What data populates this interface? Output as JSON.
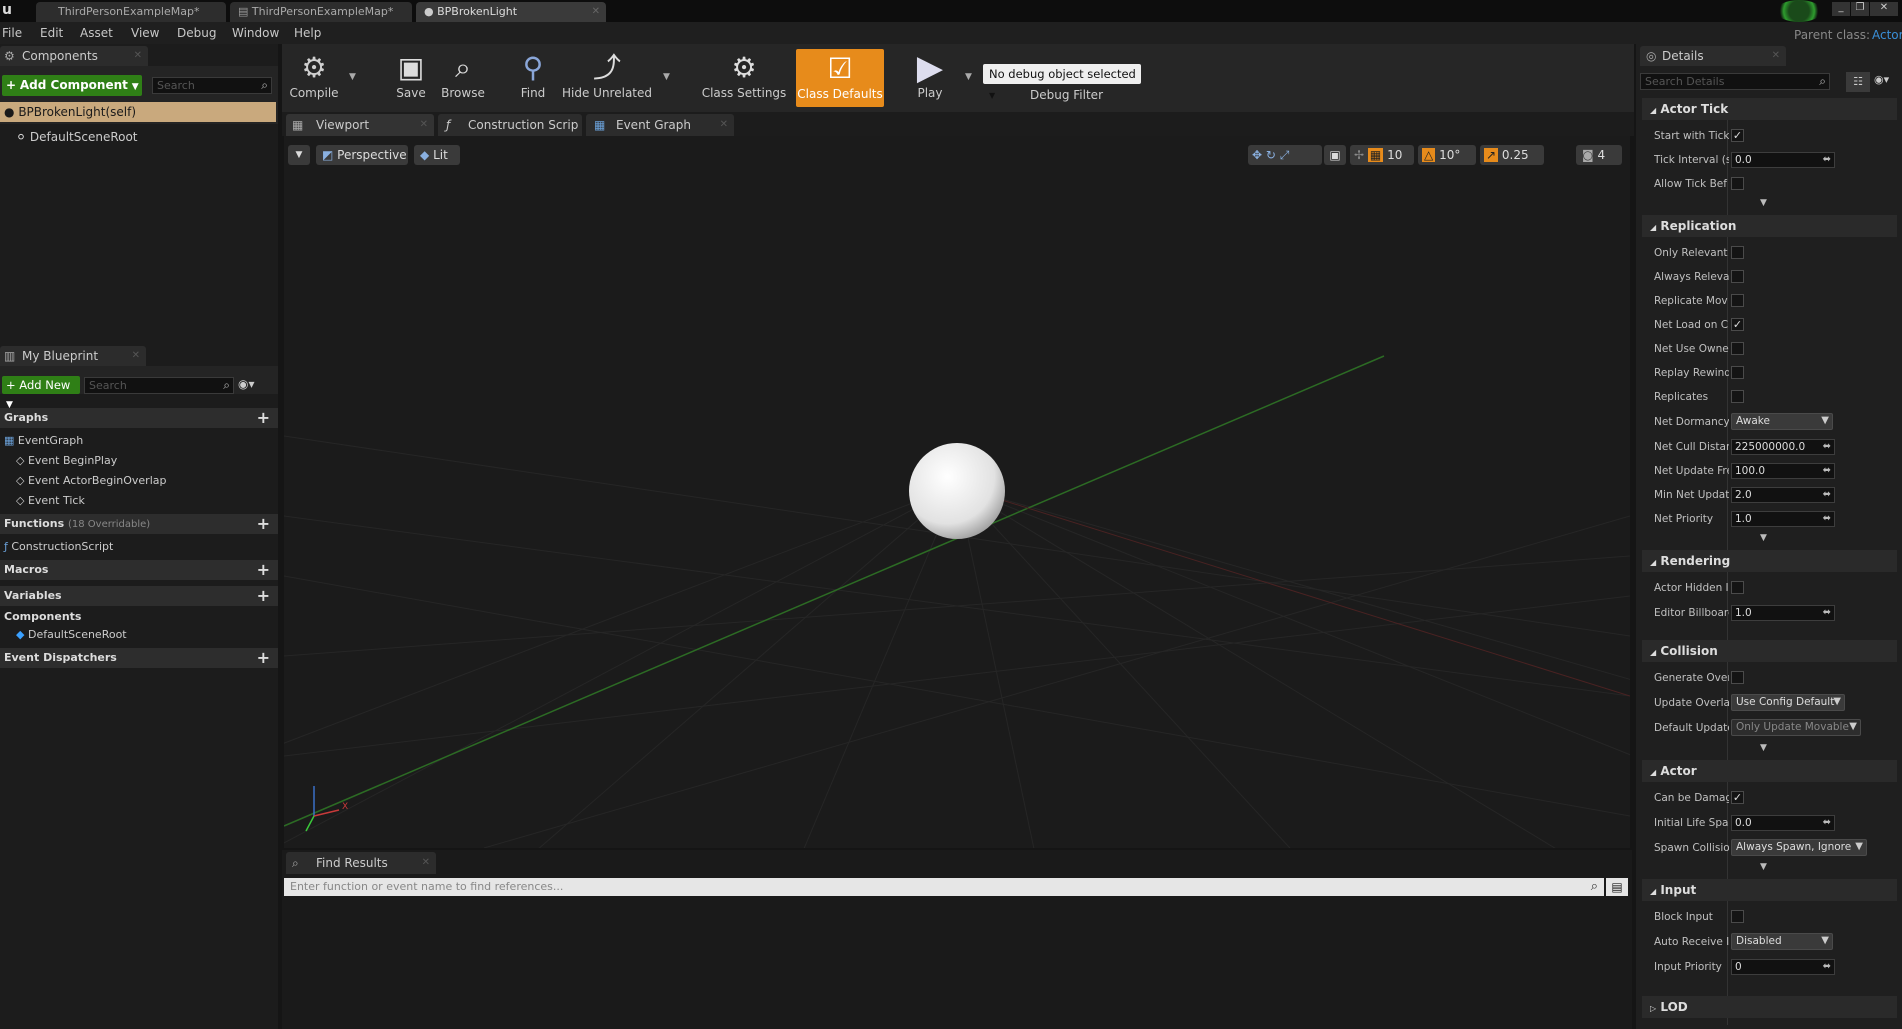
{
  "document_tabs": [
    {
      "label": "ThirdPersonExampleMap*"
    },
    {
      "label": "ThirdPersonExampleMap*"
    },
    {
      "label": "BPBrokenLight"
    }
  ],
  "parent_class": {
    "label": "Parent class:",
    "value": "Actor"
  },
  "menu": [
    "File",
    "Edit",
    "Asset",
    "View",
    "Debug",
    "Window",
    "Help"
  ],
  "components_panel": {
    "tab": "Components",
    "add_button": "Add Component",
    "search_placeholder": "Search",
    "items": [
      "BPBrokenLight(self)",
      "DefaultSceneRoot"
    ]
  },
  "my_blueprint": {
    "tab": "My Blueprint",
    "add_button": "Add New",
    "search_placeholder": "Search",
    "graphs_label": "Graphs",
    "event_graph": "EventGraph",
    "events": [
      "Event BeginPlay",
      "Event ActorBeginOverlap",
      "Event Tick"
    ],
    "functions_label": "Functions",
    "functions_count": "(18 Overridable)",
    "construction_script": "ConstructionScript",
    "macros_label": "Macros",
    "variables_label": "Variables",
    "components_label": "Components",
    "component_item": "DefaultSceneRoot",
    "dispatchers_label": "Event Dispatchers"
  },
  "toolbar": {
    "compile": "Compile",
    "save": "Save",
    "browse": "Browse",
    "find": "Find",
    "hide_unrelated": "Hide Unrelated",
    "class_settings": "Class Settings",
    "class_defaults": "Class Defaults",
    "play": "Play",
    "debug_select": "No debug object selected",
    "debug_filter": "Debug Filter"
  },
  "editor_tabs": [
    "Viewport",
    "Construction Scrip",
    "Event Graph"
  ],
  "viewport": {
    "perspective": "Perspective",
    "lit": "Lit",
    "grid_snap": "10",
    "rotation_snap": "10°",
    "scale_snap": "0.25",
    "camera_speed": "4",
    "axis_x": "X"
  },
  "find_results": {
    "tab": "Find Results",
    "placeholder": "Enter function or event name to find references..."
  },
  "details": {
    "tab": "Details",
    "search_placeholder": "Search Details",
    "sections": {
      "actor_tick": "Actor Tick",
      "replication": "Replication",
      "rendering": "Rendering",
      "collision": "Collision",
      "actor": "Actor",
      "input": "Input",
      "lod": "LOD"
    },
    "props": {
      "start_with_tick": "Start with Tick",
      "tick_interval": "Tick Interval (s",
      "tick_interval_val": "0.0",
      "allow_tick": "Allow Tick Bef",
      "only_relevant": "Only Relevant",
      "always_relevant": "Always Releva",
      "replicate_movement": "Replicate Mov",
      "net_load": "Net Load on Cl",
      "net_use_owner": "Net Use Owner",
      "replay_rewind": "Replay Rewind",
      "replicates": "Replicates",
      "net_dormancy": "Net Dormancy",
      "net_dormancy_val": "Awake",
      "net_cull": "Net Cull Distar",
      "net_cull_val": "225000000.0",
      "net_update_freq": "Net Update Fre",
      "net_update_freq_val": "100.0",
      "min_net_update": "Min Net Updat",
      "min_net_update_val": "2.0",
      "net_priority": "Net Priority",
      "net_priority_val": "1.0",
      "actor_hidden": "Actor Hidden I",
      "editor_billboard": "Editor Billboarc",
      "editor_billboard_val": "1.0",
      "generate_overlap": "Generate Over",
      "update_overlap": "Update Overla",
      "update_overlap_val": "Use Config Default",
      "default_update": "Default Update",
      "default_update_val": "Only Update Movable",
      "can_be_damaged": "Can be Damag",
      "initial_life": "Initial Life Spa",
      "initial_life_val": "0.0",
      "spawn_collision": "Spawn Collisio",
      "spawn_collision_val": "Always Spawn, Ignore C",
      "block_input": "Block Input",
      "auto_receive": "Auto Receive I",
      "auto_receive_val": "Disabled",
      "input_priority": "Input Priority",
      "input_priority_val": "0"
    }
  }
}
